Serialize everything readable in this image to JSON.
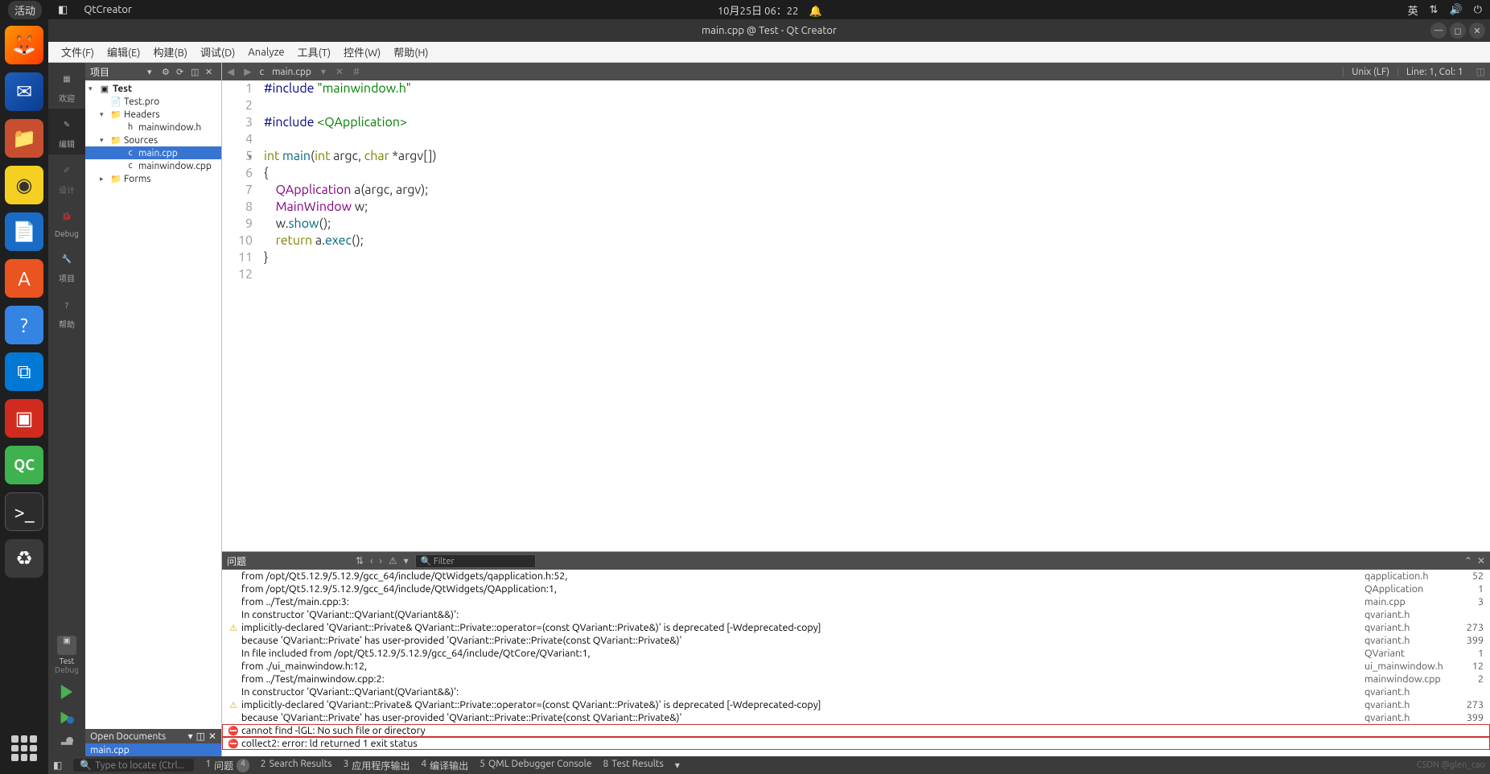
{
  "system_bar": {
    "activity": "活动",
    "app": "QtCreator",
    "datetime": "10月25日 06：22",
    "ime": "英"
  },
  "title_bar": {
    "title": "main.cpp @ Test - Qt Creator"
  },
  "menu": {
    "file": "文件(F)",
    "edit": "编辑(E)",
    "build": "构建(B)",
    "debug": "调试(D)",
    "analyze": "Analyze",
    "tools": "工具(T)",
    "widgets": "控件(W)",
    "help": "帮助(H)"
  },
  "mode_bar": {
    "welcome": "欢迎",
    "edit": "编辑",
    "design": "设计",
    "debug": "Debug",
    "project": "项目",
    "help": "帮助",
    "kit_name": "Test",
    "kit_config": "Debug"
  },
  "sidebar": {
    "header": "项目",
    "tree": {
      "project": "Test",
      "pro": "Test.pro",
      "headers": "Headers",
      "header_file": "mainwindow.h",
      "sources": "Sources",
      "main": "main.cpp",
      "mw_cpp": "mainwindow.cpp",
      "forms": "Forms"
    },
    "open_docs_header": "Open Documents",
    "open_doc": "main.cpp"
  },
  "editor": {
    "filename": "main.cpp",
    "hash": "#",
    "encoding": "Unix (LF)",
    "cursor": "Line: 1, Col: 1",
    "code_lines": [
      {
        "n": 1,
        "html": "<span class='pp'>#include</span> <span class='str'>\"mainwindow.h\"</span>"
      },
      {
        "n": 2,
        "html": ""
      },
      {
        "n": 3,
        "html": "<span class='pp'>#include</span> <span class='str'>&lt;QApplication&gt;</span>"
      },
      {
        "n": 4,
        "html": ""
      },
      {
        "n": 5,
        "html": "<span class='kw'>int</span> <span class='fn'>main</span>(<span class='kw'>int</span> argc, <span class='kw'>char</span> *argv[])",
        "fold": true
      },
      {
        "n": 6,
        "html": "{"
      },
      {
        "n": 7,
        "html": "    <span class='type'>QApplication</span> <span>a</span>(argc, argv);"
      },
      {
        "n": 8,
        "html": "    <span class='type'>MainWindow</span> w;"
      },
      {
        "n": 9,
        "html": "    w.<span class='fn'>show</span>();"
      },
      {
        "n": 10,
        "html": "    <span class='kw'>return</span> a.<span class='fn'>exec</span>();"
      },
      {
        "n": 11,
        "html": "}"
      },
      {
        "n": 12,
        "html": ""
      }
    ]
  },
  "issues": {
    "header": "问题",
    "filter_placeholder": "Filter",
    "rows": [
      {
        "icon": "",
        "msg": "from /opt/Qt5.12.9/5.12.9/gcc_64/include/QtWidgets/qapplication.h:52,",
        "file": "qapplication.h",
        "line": "52"
      },
      {
        "icon": "",
        "msg": "from /opt/Qt5.12.9/5.12.9/gcc_64/include/QtWidgets/QApplication:1,",
        "file": "QApplication",
        "line": "1"
      },
      {
        "icon": "",
        "msg": "from ../Test/main.cpp:3:",
        "file": "main.cpp",
        "line": "3"
      },
      {
        "icon": "",
        "msg": "In constructor 'QVariant::QVariant(QVariant&&)':",
        "file": "qvariant.h",
        "line": ""
      },
      {
        "icon": "warn",
        "msg": "implicitly-declared 'QVariant::Private& QVariant::Private::operator=(const QVariant::Private&)' is deprecated [-Wdeprecated-copy]",
        "file": "qvariant.h",
        "line": "273"
      },
      {
        "icon": "",
        "msg": "because 'QVariant::Private' has user-provided 'QVariant::Private::Private(const QVariant::Private&)'",
        "file": "qvariant.h",
        "line": "399"
      },
      {
        "icon": "",
        "msg": "In file included from /opt/Qt5.12.9/5.12.9/gcc_64/include/QtCore/QVariant:1,",
        "file": "QVariant",
        "line": "1"
      },
      {
        "icon": "",
        "msg": "from ./ui_mainwindow.h:12,",
        "file": "ui_mainwindow.h",
        "line": "12"
      },
      {
        "icon": "",
        "msg": "from ../Test/mainwindow.cpp:2:",
        "file": "mainwindow.cpp",
        "line": "2"
      },
      {
        "icon": "",
        "msg": "In constructor 'QVariant::QVariant(QVariant&&)':",
        "file": "qvariant.h",
        "line": ""
      },
      {
        "icon": "warn",
        "msg": "implicitly-declared 'QVariant::Private& QVariant::Private::operator=(const QVariant::Private&)' is deprecated [-Wdeprecated-copy]",
        "file": "qvariant.h",
        "line": "273"
      },
      {
        "icon": "",
        "msg": "because 'QVariant::Private' has user-provided 'QVariant::Private::Private(const QVariant::Private&)'",
        "file": "qvariant.h",
        "line": "399"
      },
      {
        "icon": "err",
        "msg": "cannot find -lGL: No such file or directory",
        "file": "",
        "line": "",
        "boxed": true
      },
      {
        "icon": "err",
        "msg": "collect2: error: ld returned 1 exit status",
        "file": "",
        "line": "",
        "boxed": true
      }
    ]
  },
  "status": {
    "locator": "Type to locate (Ctrl...",
    "tabs": [
      {
        "n": "1",
        "label": "问题",
        "badge": "4"
      },
      {
        "n": "2",
        "label": "Search Results"
      },
      {
        "n": "3",
        "label": "应用程序输出"
      },
      {
        "n": "4",
        "label": "编译输出"
      },
      {
        "n": "5",
        "label": "QML Debugger Console"
      },
      {
        "n": "8",
        "label": "Test Results"
      }
    ],
    "watermark": "CSDN @glen_cao"
  }
}
